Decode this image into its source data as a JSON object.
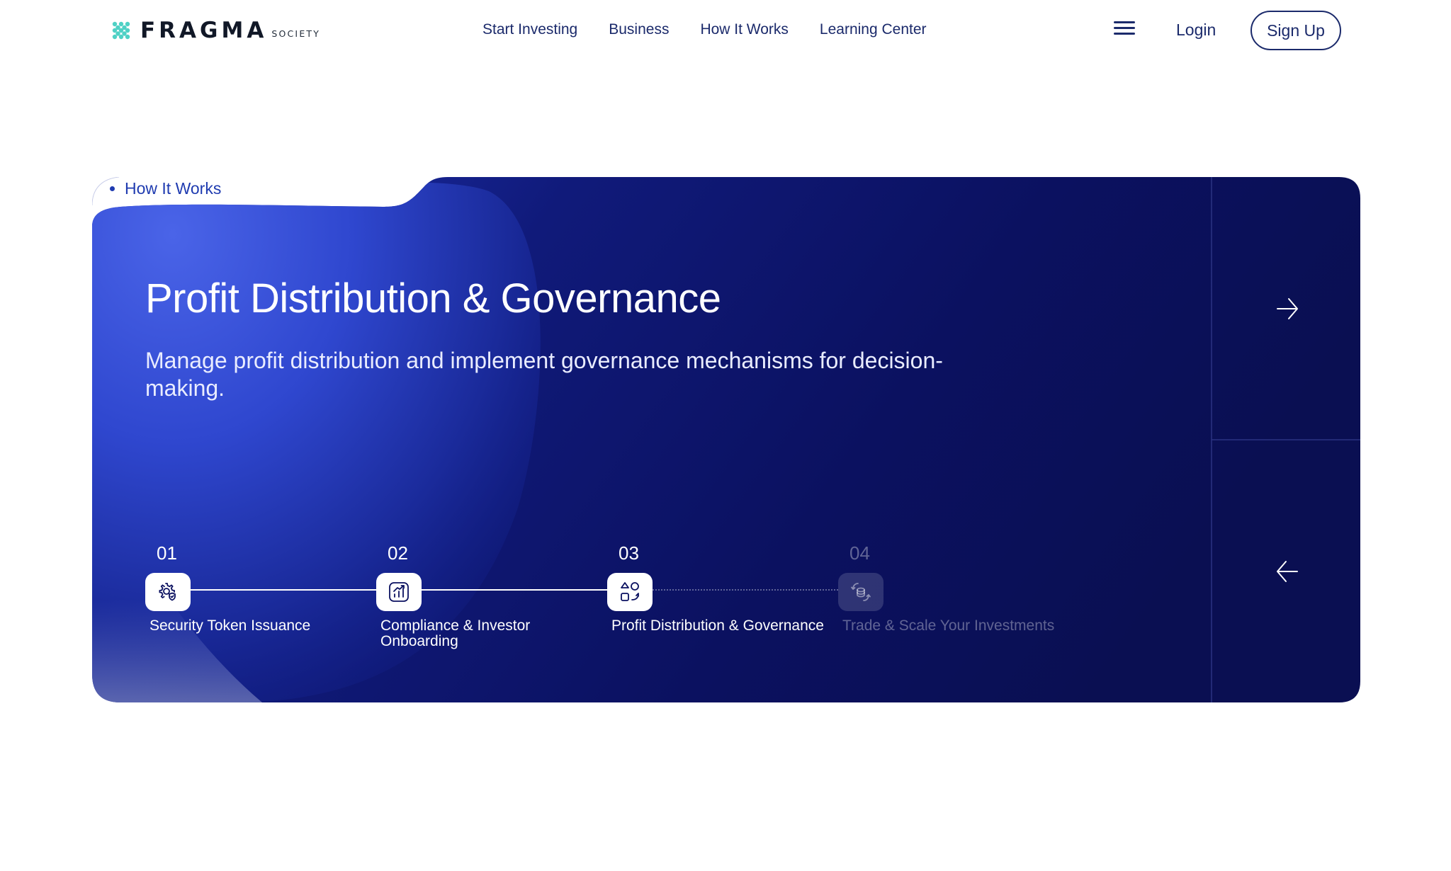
{
  "brand": {
    "name": "FRAGMA",
    "sub": "SOCIETY",
    "accent": "#4fd1c5"
  },
  "nav": {
    "items": [
      "Start Investing",
      "Business",
      "How It Works",
      "Learning Center"
    ],
    "menu_icon": "hamburger-icon",
    "login_label": "Login",
    "signup_label": "Sign Up"
  },
  "section": {
    "label": "How It Works"
  },
  "hero": {
    "title": "Profit Distribution & Governance",
    "description": "Manage profit distribution and implement governance mechanisms for decision-making.",
    "next_icon": "arrow-right-icon",
    "prev_icon": "arrow-left-icon",
    "colors": {
      "dark_navy": "#0b1052",
      "blue": "#3f5be0"
    }
  },
  "steps": [
    {
      "number": "01",
      "label": "Security Token Issuance",
      "icon": "gear-shield-icon",
      "active": true
    },
    {
      "number": "02",
      "label": "Compliance & Investor Onboarding",
      "icon": "chart-icon",
      "active": true
    },
    {
      "number": "03",
      "label": "Profit Distribution & Governance",
      "icon": "shapes-icon",
      "active": true
    },
    {
      "number": "04",
      "label": "Trade & Scale Your Investments",
      "icon": "coins-exchange-icon",
      "active": false
    }
  ]
}
